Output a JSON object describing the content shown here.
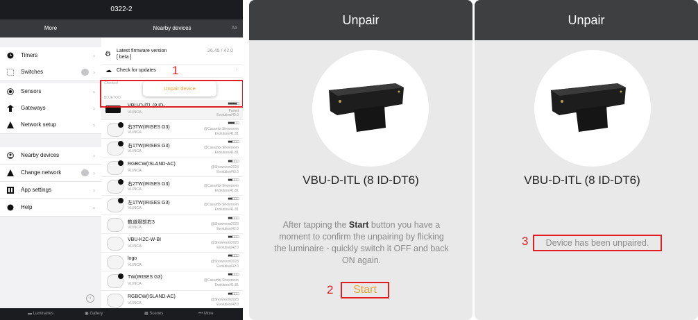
{
  "app": {
    "title": "0322-2",
    "more_header": "More",
    "nearby_header": "Nearby devices",
    "aa": "Aa",
    "sidebar": [
      {
        "label": "Timers",
        "icon": "clock-icon"
      },
      {
        "label": "Switches",
        "icon": "switch-icon"
      },
      {
        "label": "Sensors",
        "icon": "sensor-icon"
      },
      {
        "label": "Gateways",
        "icon": "gateway-icon"
      },
      {
        "label": "Network setup",
        "icon": "network-icon"
      },
      {
        "label": "Nearby devices",
        "icon": "nearby-icon"
      },
      {
        "label": "Change network",
        "icon": "change-network-icon"
      },
      {
        "label": "App settings",
        "icon": "settings-icon"
      },
      {
        "label": "Help",
        "icon": "help-icon"
      }
    ],
    "firmware": {
      "title": "Latest firmware version",
      "beta": "[ beta ]",
      "version": "26.45 / 42.0"
    },
    "check_updates": "Check for updates",
    "checked_prefix": "Checked",
    "bluetooth_prefix": "BLUETOO",
    "unpair_button": "Unpair device",
    "selected_device": {
      "name": "VBU-D-ITL (8 ID-",
      "vendor": "VLINCA",
      "signal": "■■■■□",
      "status": "Paired",
      "fw": "Evolution/42.0"
    },
    "devices": [
      {
        "name": "右3TW(IRISES G3)",
        "vendor": "VLINCA",
        "signal": "■■■□□",
        "loc1": "@Casambi Showroom",
        "loc2": "Evolution/41.81"
      },
      {
        "name": "右1TW(IRISES G3)",
        "vendor": "VLINCA",
        "signal": "■■□□□",
        "loc1": "@Casambi Showroom",
        "loc2": "Evolution/41.81"
      },
      {
        "name": "RGBCW(ISLAND-AC)",
        "vendor": "VLINCA",
        "signal": "■■□□□",
        "loc1": "@Showroom2023",
        "loc2": "Evolution/42.0"
      },
      {
        "name": "右2TW(IRISES G3)",
        "vendor": "VLINCA",
        "signal": "■■□□□",
        "loc1": "@Casambi Showroom",
        "loc2": "Evolution/41.81"
      },
      {
        "name": "左1TW(IRISES G3)",
        "vendor": "VLINCA",
        "signal": "■■□□□",
        "loc1": "@Casambi Showroom",
        "loc2": "Evolution/41.81"
      },
      {
        "name": "軌道燈前右3",
        "vendor": "VLINCA",
        "signal": "■■□□□",
        "loc1": "@Showroom2023",
        "loc2": "Evolution/42.0"
      },
      {
        "name": "VBU-K2C-W-BI",
        "vendor": "VLINCA",
        "signal": "■■□□□",
        "loc1": "@Showroom2023",
        "loc2": "Evolution/42.0"
      },
      {
        "name": "logo",
        "vendor": "VLINCA",
        "signal": "■■□□□",
        "loc1": "@Showroom2023",
        "loc2": "Evolution/42.0"
      },
      {
        "name": "TW(IRISES G3)",
        "vendor": "VLINCA",
        "signal": "■■□□□",
        "loc1": "@Casambi Showroom",
        "loc2": "Evolution/41.81"
      },
      {
        "name": "RGBCW(ISLAND-AC)",
        "vendor": "VLINCA",
        "signal": "■■□□□",
        "loc1": "@Showroom2023",
        "loc2": "Evolution/42.0"
      }
    ],
    "tabs": [
      "Luminaires",
      "Gallery",
      "Scenes",
      "More"
    ]
  },
  "annotations": {
    "step1": "1",
    "step2": "2",
    "step3": "3"
  },
  "unpair_screen": {
    "title": "Unpair",
    "device_name": "VBU-D-ITL (8  ID-DT6)",
    "instruction_1": "After tapping the ",
    "instruction_bold": "Start",
    "instruction_2": " button you have a moment to confirm the unpairing by flicking the luminaire - quickly switch it OFF and back ON again.",
    "start_button": "Start"
  },
  "done_screen": {
    "title": "Unpair",
    "device_name": "VBU-D-ITL (8  ID-DT6)",
    "status": "Device has been unpaired."
  },
  "colors": {
    "accent": "#e8a23a",
    "annotation_red": "#e21e1e",
    "header_dark": "#3e3f41"
  }
}
